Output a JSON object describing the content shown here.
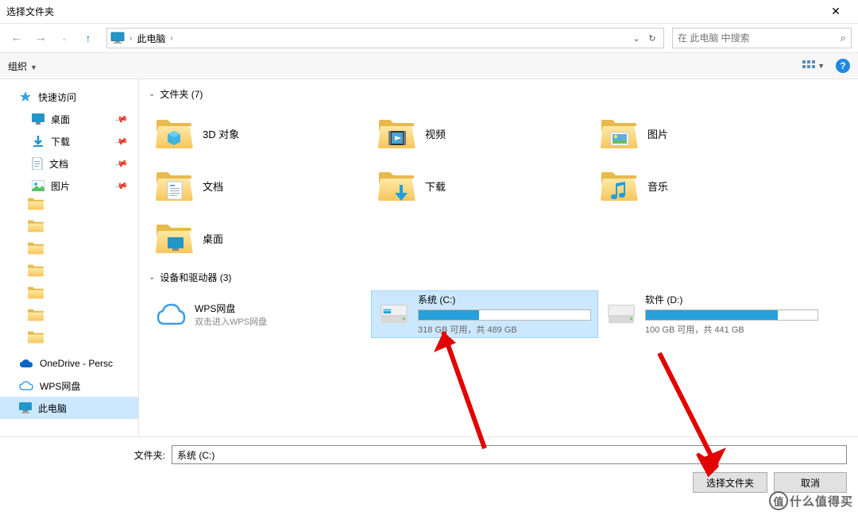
{
  "window": {
    "title": "选择文件夹",
    "close": "✕"
  },
  "nav": {
    "crumb": "此电脑",
    "sep": "›",
    "refresh": "↻",
    "drop": "⌄"
  },
  "search": {
    "placeholder": "在 此电脑 中搜索"
  },
  "toolbar": {
    "organize": "组织",
    "dd": "▼"
  },
  "sidebar": {
    "quick": "快速访问",
    "desktop": "桌面",
    "downloads": "下载",
    "documents": "文档",
    "pictures": "图片",
    "onedrive": "OneDrive - Persc",
    "wps": "WPS网盘",
    "thispc": "此电脑"
  },
  "sections": {
    "folders": "文件夹 (7)",
    "drives": "设备和驱动器 (3)"
  },
  "folders": {
    "objects3d": "3D 对象",
    "videos": "视频",
    "pictures": "图片",
    "documents": "文档",
    "downloads": "下载",
    "music": "音乐",
    "desktop": "桌面"
  },
  "wps": {
    "name": "WPS网盘",
    "hint": "双击进入WPS网盘"
  },
  "drives": {
    "c": {
      "name": "系统 (C:)",
      "stat": "318 GB 可用，共 489 GB",
      "fillpct": "35%"
    },
    "d": {
      "name": "软件 (D:)",
      "stat": "100 GB 可用，共 441 GB",
      "fillpct": "77%"
    }
  },
  "footer": {
    "label": "文件夹:",
    "value": "系统 (C:)",
    "select": "选择文件夹",
    "cancel": "取消"
  },
  "watermark": {
    "char": "值",
    "text": "什么值得买"
  }
}
